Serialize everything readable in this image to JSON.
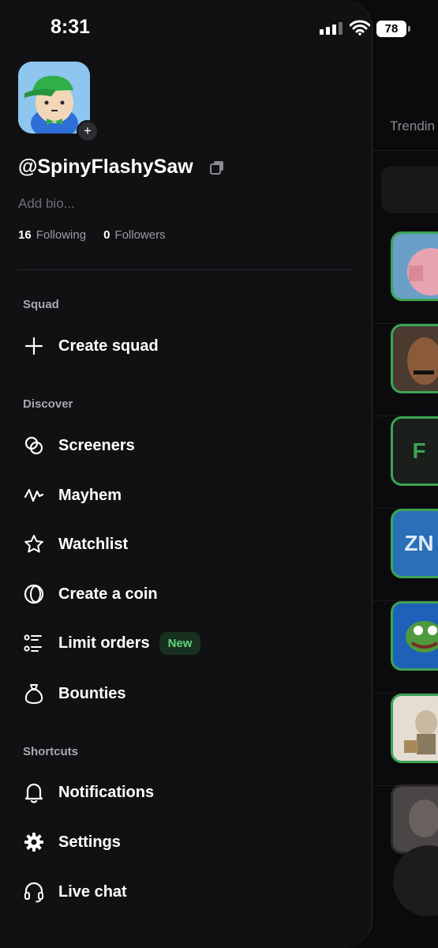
{
  "status_bar": {
    "time": "8:31",
    "battery": "78"
  },
  "background": {
    "tab_label": "Trendin",
    "thumbs": [
      {
        "text": ""
      },
      {
        "text": ""
      },
      {
        "text": "F"
      },
      {
        "text": "ZN"
      },
      {
        "text": ""
      },
      {
        "text": ""
      },
      {
        "text": ""
      }
    ]
  },
  "profile": {
    "username": "@SpinyFlashySaw",
    "bio_placeholder": "Add bio...",
    "following_count": "16",
    "following_label": "Following",
    "followers_count": "0",
    "followers_label": "Followers"
  },
  "sections": {
    "squad": "Squad",
    "discover": "Discover",
    "shortcuts": "Shortcuts"
  },
  "menu": {
    "create_squad": "Create squad",
    "screeners": "Screeners",
    "mayhem": "Mayhem",
    "watchlist": "Watchlist",
    "create_coin": "Create a coin",
    "limit_orders": "Limit orders",
    "limit_orders_badge": "New",
    "bounties": "Bounties",
    "notifications": "Notifications",
    "settings": "Settings",
    "live_chat": "Live chat"
  },
  "colors": {
    "drawer_bg": "#111114",
    "accent_green": "#3ca553",
    "badge_text": "#5fd37c"
  }
}
